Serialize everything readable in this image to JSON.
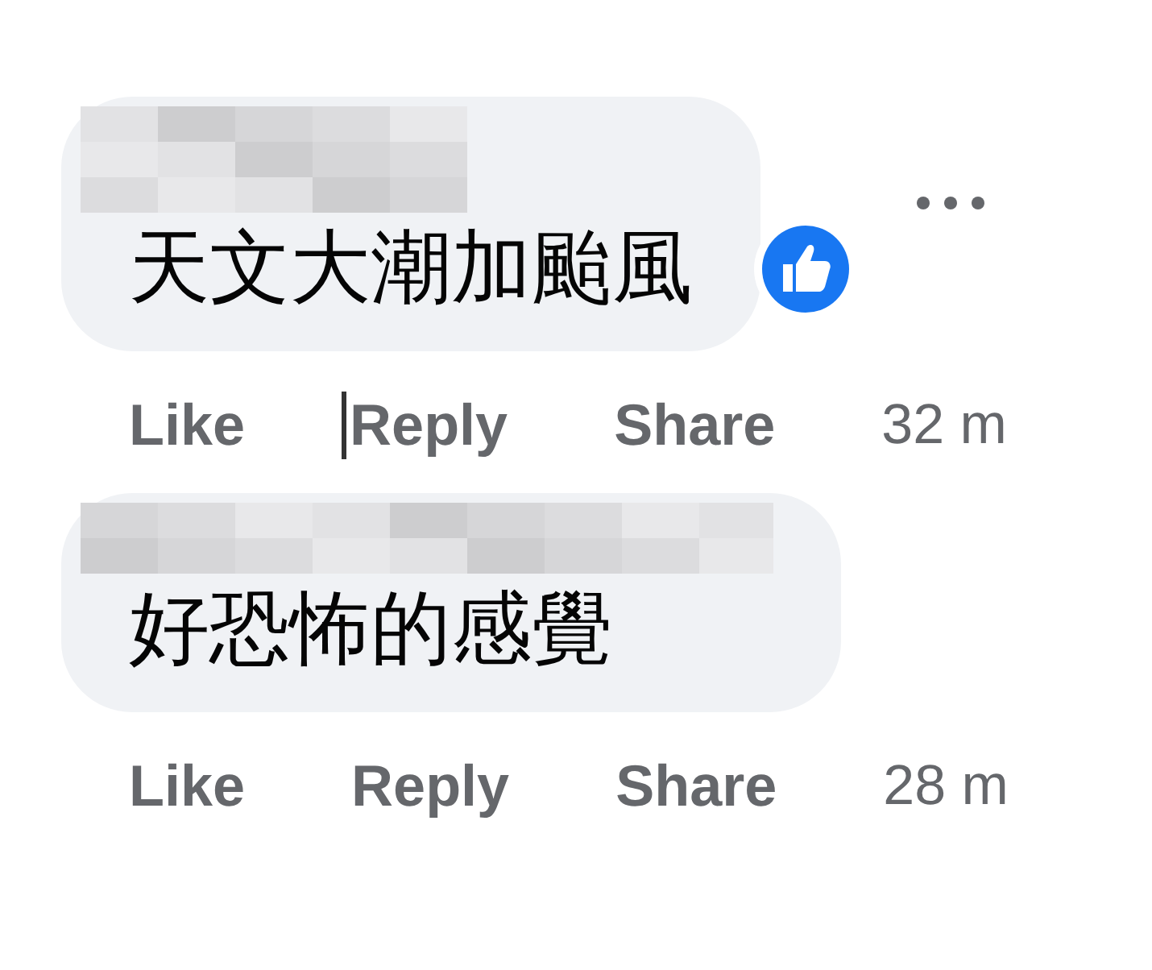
{
  "comments": [
    {
      "text": "天文大潮加颱風",
      "liked": true,
      "actions": [
        {
          "label": "Like"
        },
        {
          "label": "Reply"
        },
        {
          "label": "Share"
        }
      ],
      "time": "32 m",
      "text_cursor": true
    },
    {
      "text": "好恐怖的感覺",
      "liked": false,
      "actions": [
        {
          "label": "Like"
        },
        {
          "label": "Reply"
        },
        {
          "label": "Share"
        }
      ],
      "time": "28 m",
      "text_cursor": false
    }
  ]
}
